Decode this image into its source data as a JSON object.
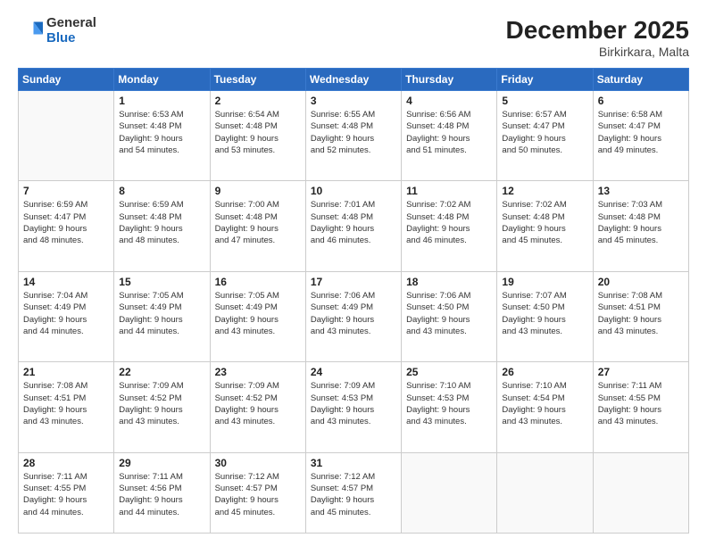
{
  "header": {
    "logo": {
      "general": "General",
      "blue": "Blue"
    },
    "title": "December 2025",
    "location": "Birkirkara, Malta"
  },
  "calendar": {
    "headers": [
      "Sunday",
      "Monday",
      "Tuesday",
      "Wednesday",
      "Thursday",
      "Friday",
      "Saturday"
    ],
    "weeks": [
      [
        {
          "day": "",
          "info": ""
        },
        {
          "day": "1",
          "info": "Sunrise: 6:53 AM\nSunset: 4:48 PM\nDaylight: 9 hours\nand 54 minutes."
        },
        {
          "day": "2",
          "info": "Sunrise: 6:54 AM\nSunset: 4:48 PM\nDaylight: 9 hours\nand 53 minutes."
        },
        {
          "day": "3",
          "info": "Sunrise: 6:55 AM\nSunset: 4:48 PM\nDaylight: 9 hours\nand 52 minutes."
        },
        {
          "day": "4",
          "info": "Sunrise: 6:56 AM\nSunset: 4:48 PM\nDaylight: 9 hours\nand 51 minutes."
        },
        {
          "day": "5",
          "info": "Sunrise: 6:57 AM\nSunset: 4:47 PM\nDaylight: 9 hours\nand 50 minutes."
        },
        {
          "day": "6",
          "info": "Sunrise: 6:58 AM\nSunset: 4:47 PM\nDaylight: 9 hours\nand 49 minutes."
        }
      ],
      [
        {
          "day": "7",
          "info": "Sunrise: 6:59 AM\nSunset: 4:47 PM\nDaylight: 9 hours\nand 48 minutes."
        },
        {
          "day": "8",
          "info": "Sunrise: 6:59 AM\nSunset: 4:48 PM\nDaylight: 9 hours\nand 48 minutes."
        },
        {
          "day": "9",
          "info": "Sunrise: 7:00 AM\nSunset: 4:48 PM\nDaylight: 9 hours\nand 47 minutes."
        },
        {
          "day": "10",
          "info": "Sunrise: 7:01 AM\nSunset: 4:48 PM\nDaylight: 9 hours\nand 46 minutes."
        },
        {
          "day": "11",
          "info": "Sunrise: 7:02 AM\nSunset: 4:48 PM\nDaylight: 9 hours\nand 46 minutes."
        },
        {
          "day": "12",
          "info": "Sunrise: 7:02 AM\nSunset: 4:48 PM\nDaylight: 9 hours\nand 45 minutes."
        },
        {
          "day": "13",
          "info": "Sunrise: 7:03 AM\nSunset: 4:48 PM\nDaylight: 9 hours\nand 45 minutes."
        }
      ],
      [
        {
          "day": "14",
          "info": "Sunrise: 7:04 AM\nSunset: 4:49 PM\nDaylight: 9 hours\nand 44 minutes."
        },
        {
          "day": "15",
          "info": "Sunrise: 7:05 AM\nSunset: 4:49 PM\nDaylight: 9 hours\nand 44 minutes."
        },
        {
          "day": "16",
          "info": "Sunrise: 7:05 AM\nSunset: 4:49 PM\nDaylight: 9 hours\nand 43 minutes."
        },
        {
          "day": "17",
          "info": "Sunrise: 7:06 AM\nSunset: 4:49 PM\nDaylight: 9 hours\nand 43 minutes."
        },
        {
          "day": "18",
          "info": "Sunrise: 7:06 AM\nSunset: 4:50 PM\nDaylight: 9 hours\nand 43 minutes."
        },
        {
          "day": "19",
          "info": "Sunrise: 7:07 AM\nSunset: 4:50 PM\nDaylight: 9 hours\nand 43 minutes."
        },
        {
          "day": "20",
          "info": "Sunrise: 7:08 AM\nSunset: 4:51 PM\nDaylight: 9 hours\nand 43 minutes."
        }
      ],
      [
        {
          "day": "21",
          "info": "Sunrise: 7:08 AM\nSunset: 4:51 PM\nDaylight: 9 hours\nand 43 minutes."
        },
        {
          "day": "22",
          "info": "Sunrise: 7:09 AM\nSunset: 4:52 PM\nDaylight: 9 hours\nand 43 minutes."
        },
        {
          "day": "23",
          "info": "Sunrise: 7:09 AM\nSunset: 4:52 PM\nDaylight: 9 hours\nand 43 minutes."
        },
        {
          "day": "24",
          "info": "Sunrise: 7:09 AM\nSunset: 4:53 PM\nDaylight: 9 hours\nand 43 minutes."
        },
        {
          "day": "25",
          "info": "Sunrise: 7:10 AM\nSunset: 4:53 PM\nDaylight: 9 hours\nand 43 minutes."
        },
        {
          "day": "26",
          "info": "Sunrise: 7:10 AM\nSunset: 4:54 PM\nDaylight: 9 hours\nand 43 minutes."
        },
        {
          "day": "27",
          "info": "Sunrise: 7:11 AM\nSunset: 4:55 PM\nDaylight: 9 hours\nand 43 minutes."
        }
      ],
      [
        {
          "day": "28",
          "info": "Sunrise: 7:11 AM\nSunset: 4:55 PM\nDaylight: 9 hours\nand 44 minutes."
        },
        {
          "day": "29",
          "info": "Sunrise: 7:11 AM\nSunset: 4:56 PM\nDaylight: 9 hours\nand 44 minutes."
        },
        {
          "day": "30",
          "info": "Sunrise: 7:12 AM\nSunset: 4:57 PM\nDaylight: 9 hours\nand 45 minutes."
        },
        {
          "day": "31",
          "info": "Sunrise: 7:12 AM\nSunset: 4:57 PM\nDaylight: 9 hours\nand 45 minutes."
        },
        {
          "day": "",
          "info": ""
        },
        {
          "day": "",
          "info": ""
        },
        {
          "day": "",
          "info": ""
        }
      ]
    ]
  }
}
